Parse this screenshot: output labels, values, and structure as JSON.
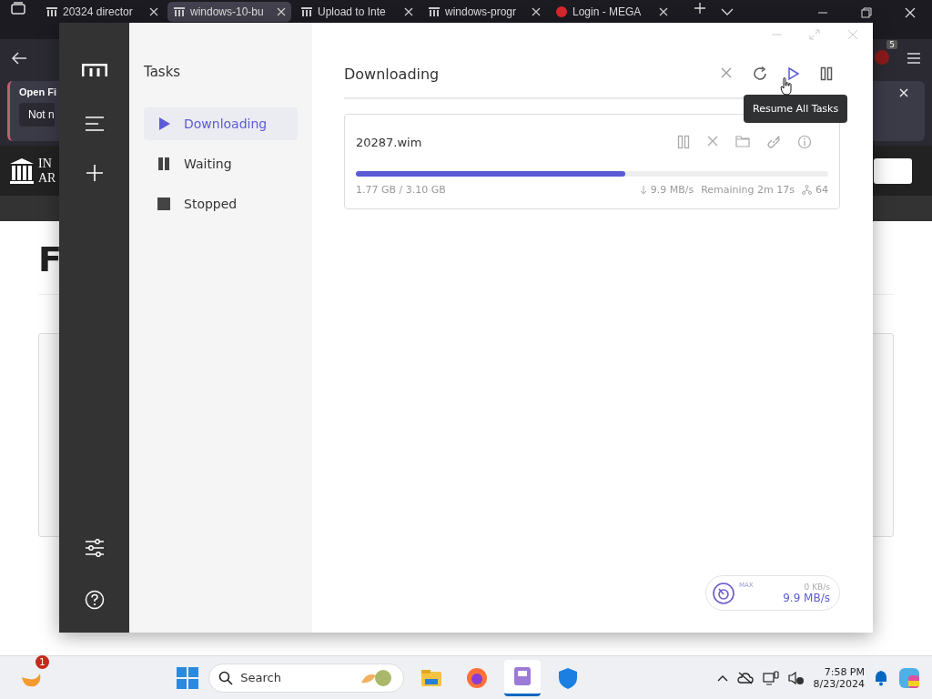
{
  "browser": {
    "tabs": [
      {
        "label": "20324 director",
        "selected": false
      },
      {
        "label": "windows-10-bu",
        "selected": true
      },
      {
        "label": "Upload to Inte",
        "selected": false
      },
      {
        "label": "windows-progr",
        "selected": false
      },
      {
        "label": "Login - MEGA",
        "selected": false,
        "kind": "mega"
      }
    ],
    "extension_badge": "5",
    "notification": {
      "title": "Open Fi",
      "button": "Not n"
    },
    "site_logo": [
      "IN",
      "AR"
    ],
    "page_heading": "F"
  },
  "app": {
    "sidebar_title": "Tasks",
    "filters": [
      {
        "label": "Downloading",
        "kind": "play",
        "selected": true
      },
      {
        "label": "Waiting",
        "kind": "pause",
        "selected": false
      },
      {
        "label": "Stopped",
        "kind": "stop",
        "selected": false
      }
    ],
    "header_title": "Downloading",
    "tooltip": "Resume All Tasks",
    "tasks": [
      {
        "name": "20287.wim",
        "level": 0.57,
        "progress_text": "1.77 GB / 3.10 GB",
        "speed": "9.9 MB/s",
        "remaining": "Remaining 2m 17s",
        "connections": "64"
      }
    ],
    "speed_meter": {
      "label": "MAX",
      "upload": "0 KB/s",
      "download": "9.9 MB/s"
    }
  },
  "taskbar": {
    "widget_badge": "1",
    "search_placeholder": "Search",
    "time": "7:58 PM",
    "date": "8/23/2024"
  }
}
